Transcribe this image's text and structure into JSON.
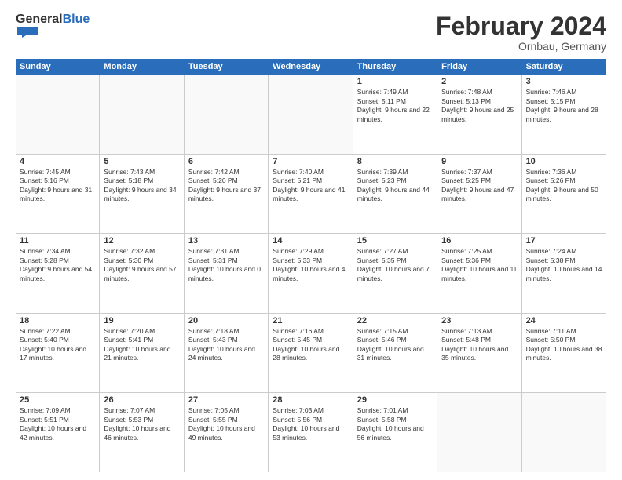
{
  "logo": {
    "general": "General",
    "blue": "Blue"
  },
  "header": {
    "title": "February 2024",
    "location": "Ornbau, Germany"
  },
  "days": [
    "Sunday",
    "Monday",
    "Tuesday",
    "Wednesday",
    "Thursday",
    "Friday",
    "Saturday"
  ],
  "weeks": [
    [
      {
        "day": "",
        "text": ""
      },
      {
        "day": "",
        "text": ""
      },
      {
        "day": "",
        "text": ""
      },
      {
        "day": "",
        "text": ""
      },
      {
        "day": "1",
        "text": "Sunrise: 7:49 AM\nSunset: 5:11 PM\nDaylight: 9 hours and 22 minutes."
      },
      {
        "day": "2",
        "text": "Sunrise: 7:48 AM\nSunset: 5:13 PM\nDaylight: 9 hours and 25 minutes."
      },
      {
        "day": "3",
        "text": "Sunrise: 7:46 AM\nSunset: 5:15 PM\nDaylight: 9 hours and 28 minutes."
      }
    ],
    [
      {
        "day": "4",
        "text": "Sunrise: 7:45 AM\nSunset: 5:16 PM\nDaylight: 9 hours and 31 minutes."
      },
      {
        "day": "5",
        "text": "Sunrise: 7:43 AM\nSunset: 5:18 PM\nDaylight: 9 hours and 34 minutes."
      },
      {
        "day": "6",
        "text": "Sunrise: 7:42 AM\nSunset: 5:20 PM\nDaylight: 9 hours and 37 minutes."
      },
      {
        "day": "7",
        "text": "Sunrise: 7:40 AM\nSunset: 5:21 PM\nDaylight: 9 hours and 41 minutes."
      },
      {
        "day": "8",
        "text": "Sunrise: 7:39 AM\nSunset: 5:23 PM\nDaylight: 9 hours and 44 minutes."
      },
      {
        "day": "9",
        "text": "Sunrise: 7:37 AM\nSunset: 5:25 PM\nDaylight: 9 hours and 47 minutes."
      },
      {
        "day": "10",
        "text": "Sunrise: 7:36 AM\nSunset: 5:26 PM\nDaylight: 9 hours and 50 minutes."
      }
    ],
    [
      {
        "day": "11",
        "text": "Sunrise: 7:34 AM\nSunset: 5:28 PM\nDaylight: 9 hours and 54 minutes."
      },
      {
        "day": "12",
        "text": "Sunrise: 7:32 AM\nSunset: 5:30 PM\nDaylight: 9 hours and 57 minutes."
      },
      {
        "day": "13",
        "text": "Sunrise: 7:31 AM\nSunset: 5:31 PM\nDaylight: 10 hours and 0 minutes."
      },
      {
        "day": "14",
        "text": "Sunrise: 7:29 AM\nSunset: 5:33 PM\nDaylight: 10 hours and 4 minutes."
      },
      {
        "day": "15",
        "text": "Sunrise: 7:27 AM\nSunset: 5:35 PM\nDaylight: 10 hours and 7 minutes."
      },
      {
        "day": "16",
        "text": "Sunrise: 7:25 AM\nSunset: 5:36 PM\nDaylight: 10 hours and 11 minutes."
      },
      {
        "day": "17",
        "text": "Sunrise: 7:24 AM\nSunset: 5:38 PM\nDaylight: 10 hours and 14 minutes."
      }
    ],
    [
      {
        "day": "18",
        "text": "Sunrise: 7:22 AM\nSunset: 5:40 PM\nDaylight: 10 hours and 17 minutes."
      },
      {
        "day": "19",
        "text": "Sunrise: 7:20 AM\nSunset: 5:41 PM\nDaylight: 10 hours and 21 minutes."
      },
      {
        "day": "20",
        "text": "Sunrise: 7:18 AM\nSunset: 5:43 PM\nDaylight: 10 hours and 24 minutes."
      },
      {
        "day": "21",
        "text": "Sunrise: 7:16 AM\nSunset: 5:45 PM\nDaylight: 10 hours and 28 minutes."
      },
      {
        "day": "22",
        "text": "Sunrise: 7:15 AM\nSunset: 5:46 PM\nDaylight: 10 hours and 31 minutes."
      },
      {
        "day": "23",
        "text": "Sunrise: 7:13 AM\nSunset: 5:48 PM\nDaylight: 10 hours and 35 minutes."
      },
      {
        "day": "24",
        "text": "Sunrise: 7:11 AM\nSunset: 5:50 PM\nDaylight: 10 hours and 38 minutes."
      }
    ],
    [
      {
        "day": "25",
        "text": "Sunrise: 7:09 AM\nSunset: 5:51 PM\nDaylight: 10 hours and 42 minutes."
      },
      {
        "day": "26",
        "text": "Sunrise: 7:07 AM\nSunset: 5:53 PM\nDaylight: 10 hours and 46 minutes."
      },
      {
        "day": "27",
        "text": "Sunrise: 7:05 AM\nSunset: 5:55 PM\nDaylight: 10 hours and 49 minutes."
      },
      {
        "day": "28",
        "text": "Sunrise: 7:03 AM\nSunset: 5:56 PM\nDaylight: 10 hours and 53 minutes."
      },
      {
        "day": "29",
        "text": "Sunrise: 7:01 AM\nSunset: 5:58 PM\nDaylight: 10 hours and 56 minutes."
      },
      {
        "day": "",
        "text": ""
      },
      {
        "day": "",
        "text": ""
      }
    ]
  ]
}
